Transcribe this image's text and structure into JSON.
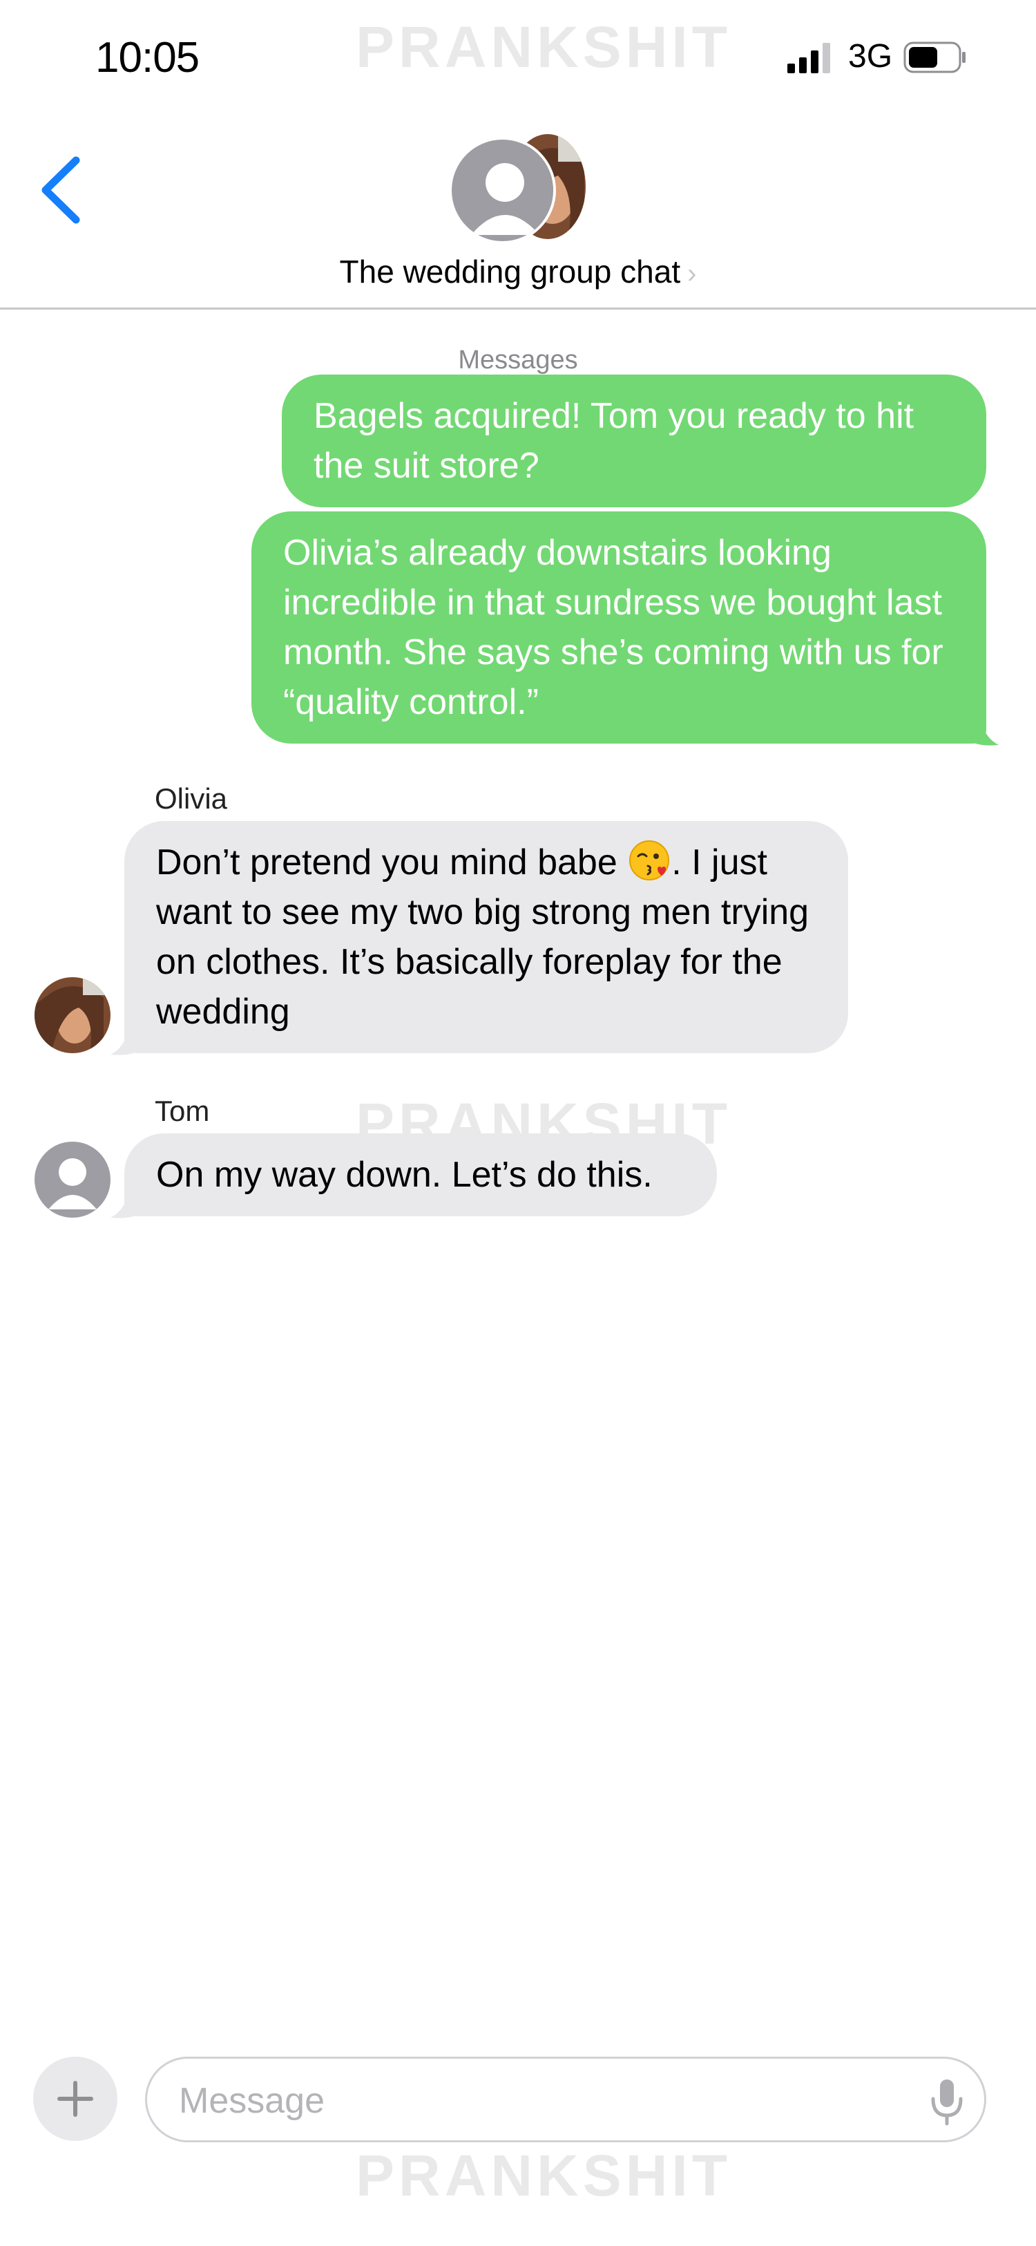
{
  "status_bar": {
    "time": "10:05",
    "network": "3G",
    "signal_bars": 3,
    "battery_level": 0.6
  },
  "watermark": "PRANKSHIT",
  "header": {
    "title": "The wedding group chat",
    "chevron": "›"
  },
  "thread": {
    "service_label": "Messages",
    "messages": [
      {
        "type": "sent",
        "text": "Bagels acquired! Tom you ready to hit the suit store?"
      },
      {
        "type": "sent",
        "text": "Olivia’s already downstairs looking incredible in that sundress we bought last month. She says she’s coming with us for “quality control.”"
      },
      {
        "type": "received",
        "sender": "Olivia",
        "text_before": "Don’t pretend you mind babe ",
        "emoji": "kissing-face-winking-emoji",
        "text_after": ". I just want to see my two big strong men trying on clothes. It’s basically foreplay for the wedding"
      },
      {
        "type": "received",
        "sender": "Tom",
        "text": "On my way down. Let’s do this."
      }
    ]
  },
  "input_bar": {
    "placeholder": "Message"
  },
  "colors": {
    "accent": "#147efb",
    "sent_bubble": "#72d873",
    "received_bubble": "#e9e9eb"
  }
}
